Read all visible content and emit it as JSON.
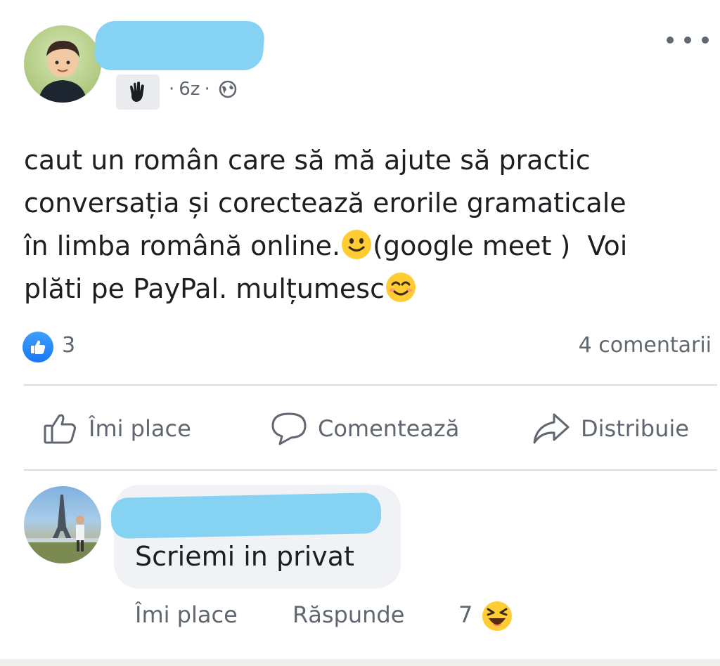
{
  "post": {
    "time": "6z",
    "separator": "·",
    "text_line1": "caut un român care să mă ajute să practic",
    "text_line2": "conversația și corectează erorile gramaticale",
    "text_line3a": "în limba română online.",
    "text_line3b": "(google meet )  Voi",
    "text_line4": "plăti pe PayPal. mulțumesc",
    "emoji_1": "slightly-smiling-face",
    "emoji_2": "smiling-face-with-smiling-eyes",
    "reaction_count": "3",
    "comment_count": "4 comentarii"
  },
  "actions": {
    "like": "Îmi place",
    "comment": "Comentează",
    "share": "Distribuie"
  },
  "comment": {
    "text": "Scriemi in privat",
    "like": "Îmi place",
    "reply": "Răspunde",
    "reaction_count": "7",
    "reaction_emoji": "laughing-face"
  },
  "colors": {
    "accent": "#1877f2",
    "redaction": "#86d2f3",
    "muted_text": "#606770",
    "bubble": "#f0f2f5"
  }
}
